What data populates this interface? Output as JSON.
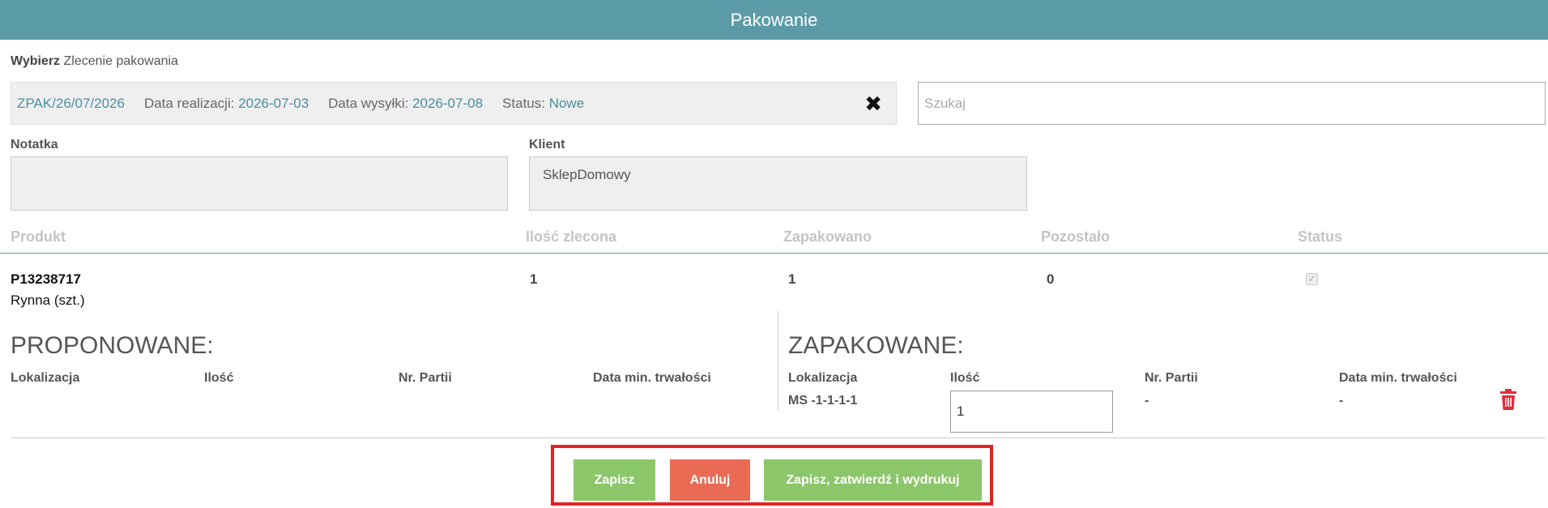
{
  "header": {
    "title": "Pakowanie"
  },
  "select": {
    "label_bold": "Wybierz",
    "label_rest": "Zlecenie pakowania"
  },
  "order": {
    "number": "ZPAK/26/07/2026",
    "realization_label": "Data realizacji:",
    "realization_value": "2026-07-03",
    "shipping_label": "Data wysyłki:",
    "shipping_value": "2026-07-08",
    "status_label": "Status:",
    "status_value": "Nowe",
    "close_icon": "✖"
  },
  "search": {
    "placeholder": "Szukaj",
    "value": ""
  },
  "note": {
    "label": "Notatka",
    "value": ""
  },
  "client": {
    "label": "Klient",
    "value": "SklepDomowy"
  },
  "table": {
    "headers": [
      "Produkt",
      "Ilość zlecona",
      "Zapakowano",
      "Pozostało",
      "Status"
    ],
    "row": {
      "code": "P13238717",
      "name": "Rynna (szt.)",
      "ordered": "1",
      "packed": "1",
      "remaining": "0",
      "status_checked": true
    }
  },
  "proposed": {
    "title": "PROPONOWANE:",
    "headers": [
      "Lokalizacja",
      "Ilość",
      "Nr. Partii",
      "Data min. trwałości"
    ]
  },
  "packed": {
    "title": "ZAPAKOWANE:",
    "headers": [
      "Lokalizacja",
      "Ilość",
      "Nr. Partii",
      "Data min. trwałości"
    ],
    "row": {
      "location": "MS -1-1-1-1",
      "quantity": "1",
      "batch": "-",
      "expiry": "-"
    },
    "delete_icon": "trash-icon",
    "delete_color": "#e02d3c"
  },
  "buttons": {
    "save": "Zapisz",
    "cancel": "Anuluj",
    "save_confirm_print": "Zapisz, zatwierdź i wydrukuj"
  },
  "colors": {
    "header_bg": "#5b9ba8",
    "accent_text": "#4a8fa0",
    "button_green": "#8cc66b",
    "button_red": "#ea6b54",
    "highlight_frame": "#e02424"
  }
}
